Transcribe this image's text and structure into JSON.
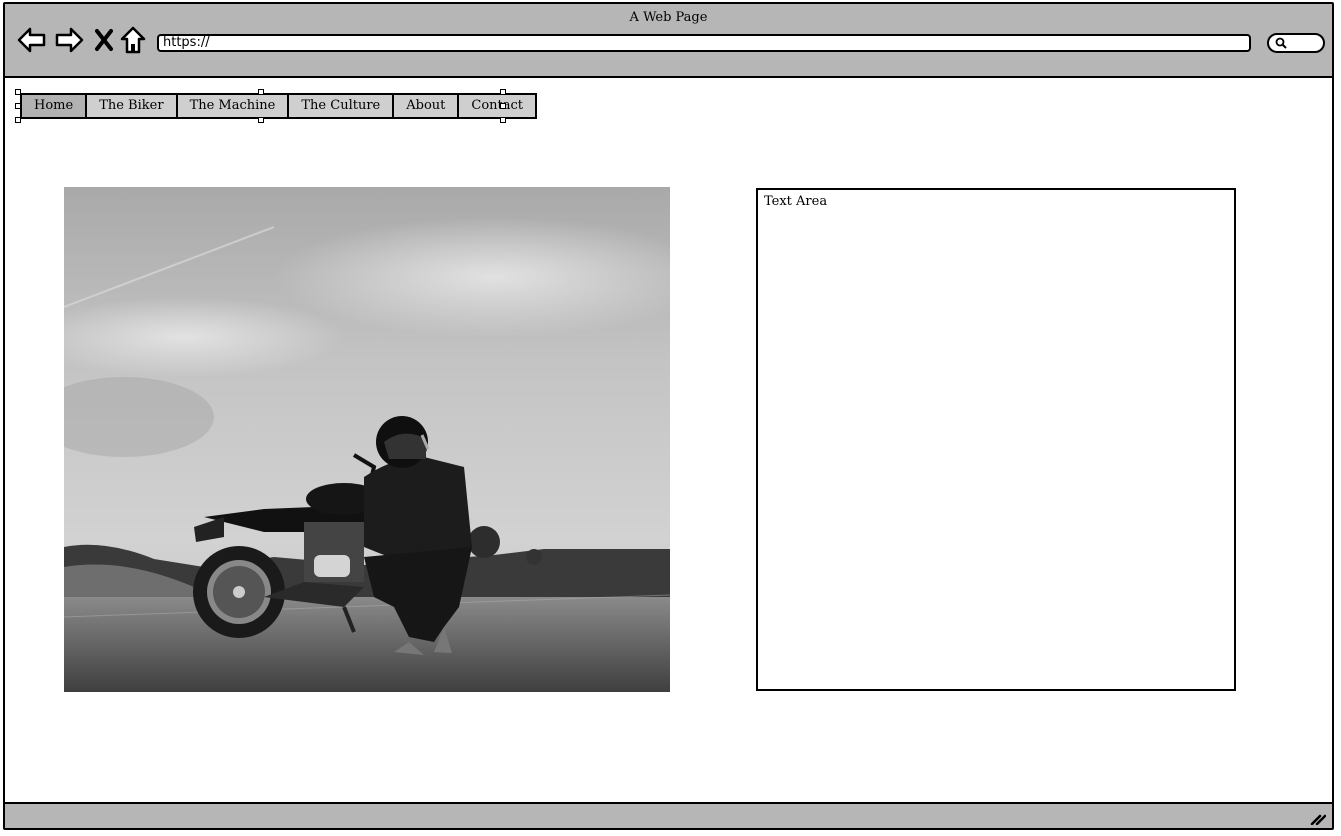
{
  "window": {
    "title": "A Web Page"
  },
  "toolbar": {
    "back_icon": "back-arrow-icon",
    "forward_icon": "forward-arrow-icon",
    "stop_icon": "close-x-icon",
    "home_icon": "home-icon",
    "url": "https://",
    "search_icon": "search-icon"
  },
  "nav": {
    "tabs": [
      {
        "label": "Home",
        "active": true
      },
      {
        "label": "The Biker",
        "active": false
      },
      {
        "label": "The Machine",
        "active": false
      },
      {
        "label": "The Culture",
        "active": false
      },
      {
        "label": "About",
        "active": false
      },
      {
        "label": "Contact",
        "active": false
      }
    ]
  },
  "main": {
    "photo_subject": "Grayscale photo of a helmeted biker crouching beside a motorcycle on a road",
    "text_area_label": "Text Area"
  },
  "colors": {
    "chrome": "#b6b6b6",
    "tab_active": "#b2b2b2",
    "tab_bg": "#cfcfcf"
  }
}
